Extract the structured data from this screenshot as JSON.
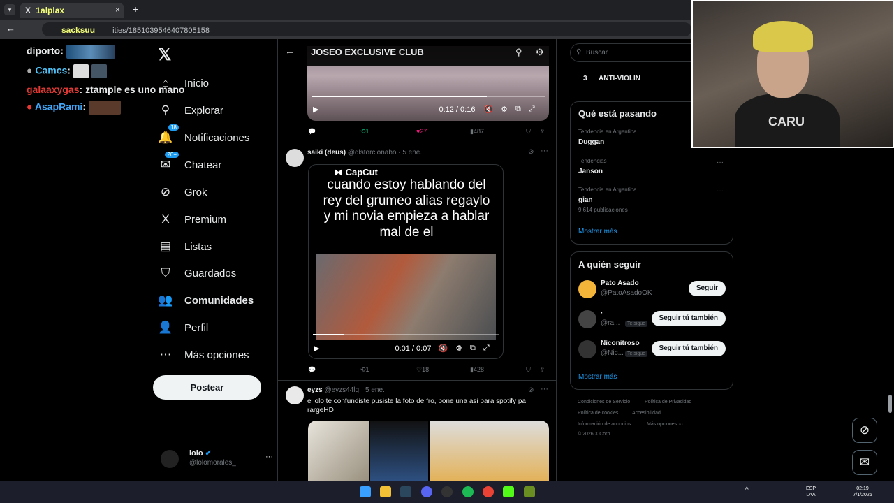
{
  "browser": {
    "tab_title": "1alplax",
    "tab_close": "×",
    "new_tab": "+",
    "address_user": "sacksuu",
    "address_text": "ities/1851039546407805158"
  },
  "chat": [
    {
      "user": "diporto",
      "color": "#e7e9ea",
      "message": ""
    },
    {
      "user": "Camcs",
      "color": "#4fc3f7",
      "message": ""
    },
    {
      "user": "galaaxygas",
      "color": "#e53935",
      "message": "ztample es uno mano"
    },
    {
      "user": "AsapRami",
      "color": "#42a5f5",
      "message": ""
    }
  ],
  "nav": {
    "items": [
      {
        "label": "Inicio",
        "icon": "home-icon",
        "glyph": "⌂",
        "badge": ""
      },
      {
        "label": "Explorar",
        "icon": "search-icon",
        "glyph": "⚲",
        "badge": ""
      },
      {
        "label": "Notificaciones",
        "icon": "bell-icon",
        "glyph": "🔔",
        "badge": "18"
      },
      {
        "label": "Chatear",
        "icon": "mail-icon",
        "glyph": "✉",
        "badge": "20+"
      },
      {
        "label": "Grok",
        "icon": "grok-icon",
        "glyph": "⊘",
        "badge": ""
      },
      {
        "label": "Premium",
        "icon": "x-icon",
        "glyph": "X",
        "badge": ""
      },
      {
        "label": "Listas",
        "icon": "list-icon",
        "glyph": "▤",
        "badge": ""
      },
      {
        "label": "Guardados",
        "icon": "bookmark-icon",
        "glyph": "⛉",
        "badge": ""
      },
      {
        "label": "Comunidades",
        "icon": "people-icon",
        "glyph": "👥",
        "badge": ""
      },
      {
        "label": "Perfil",
        "icon": "person-icon",
        "glyph": "👤",
        "badge": ""
      },
      {
        "label": "Más opciones",
        "icon": "more-circle-icon",
        "glyph": "⋯",
        "badge": ""
      }
    ],
    "post_label": "Postear",
    "me_name": "lolo",
    "me_handle": "@lolomorales_",
    "me_more": "···"
  },
  "main": {
    "header_title": "JOSEO EXCLUSIVE CLUB",
    "tweet1": {
      "time": "0:12 / 0:16",
      "progress": 0.75,
      "retweets": "1",
      "likes": "27",
      "views": "487"
    },
    "tweet2": {
      "name": "saiki (deus)",
      "handle": "@dlstorcionabo",
      "date": "· 5 ene.",
      "capcut": "CapCut",
      "caption": "cuando estoy hablando del rey del grumeo alias regaylo y mi novia empieza a hablar mal de el",
      "time": "0:01 / 0:07",
      "progress": 0.17,
      "retweets": "1",
      "likes": "18",
      "views": "428"
    },
    "tweet3": {
      "name": "eyzs",
      "handle": "@eyzs44lg",
      "date": "· 5 ene.",
      "text": "e lolo te confundiste pusiste la foto de fro, pone una asi para spotify pa rargeHD"
    }
  },
  "right": {
    "search_placeholder": "Buscar",
    "top_rank": "3",
    "top_name": "ANTI-VIOLIN",
    "trends_title": "Qué está pasando",
    "trends": [
      {
        "meta": "Tendencia en Argentina",
        "name": "Duggan",
        "count": ""
      },
      {
        "meta": "Tendencias",
        "name": "Janson",
        "count": ""
      },
      {
        "meta": "Tendencia en Argentina",
        "name": "gian",
        "count": "9.614 publicaciones"
      }
    ],
    "trends_more": "Mostrar más",
    "follow_title": "A quién seguir",
    "follow": [
      {
        "name": "Pato Asado",
        "handle": "@PatoAsadoOK",
        "tag": "",
        "button": "Seguir"
      },
      {
        "name": "·",
        "handle": "@ra...",
        "tag": "Te sigue",
        "button": "Seguir tú también"
      },
      {
        "name": "Niconitroso",
        "handle": "@Nic...",
        "tag": "Te sigue",
        "button": "Seguir tú también"
      }
    ],
    "follow_more": "Mostrar más",
    "footer": [
      "Condiciones de Servicio",
      "Política de Privacidad",
      "Política de cookies",
      "Accesibilidad",
      "Información de anuncios",
      "Más opciones ···",
      "© 2026 X Corp."
    ]
  },
  "webcam": {
    "shirt_text": "CARU"
  },
  "taskbar": {
    "lang": "ESP",
    "lang2": "LAA",
    "time": "02:19",
    "date": "7/1/2026"
  }
}
